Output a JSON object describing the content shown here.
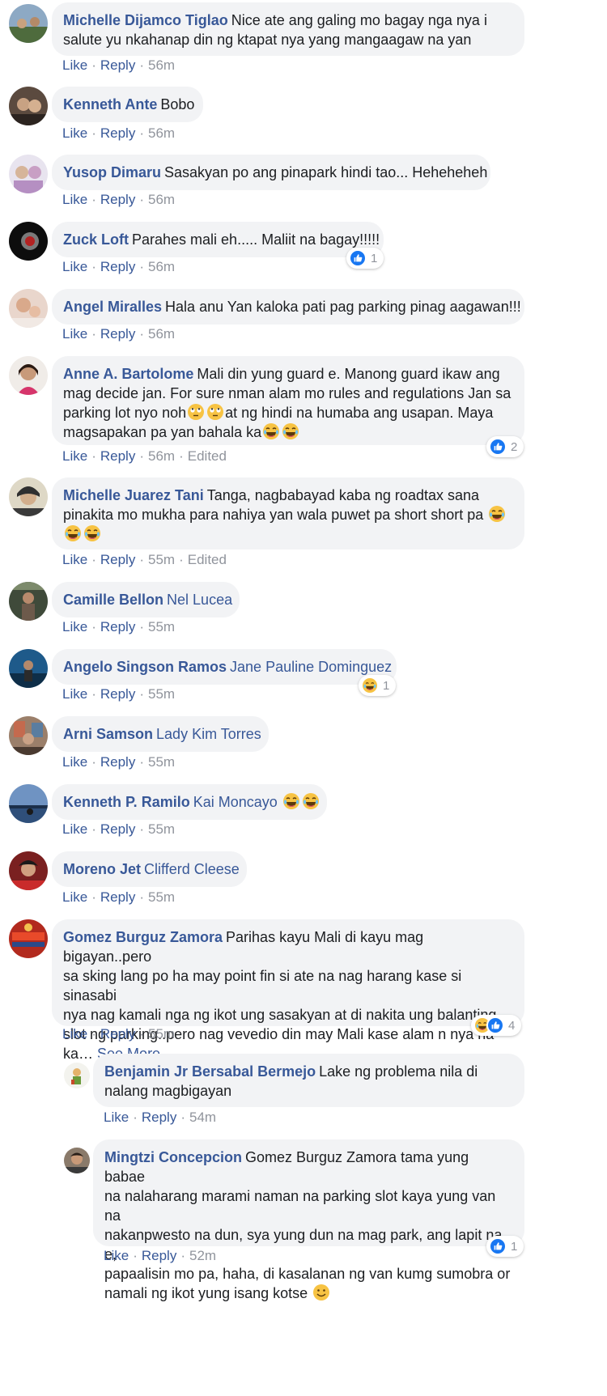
{
  "colors": {
    "link": "#385898",
    "bubble": "#f2f3f5",
    "meta": "#90949c",
    "like_blue": "#1877f2"
  },
  "actions": {
    "like": "Like",
    "reply": "Reply",
    "edited": "Edited",
    "see_more": "See More"
  },
  "comments": [
    {
      "name": "Michelle Dijamco Tiglao",
      "line1": "Nice ate ang galing mo bagay nga nya i",
      "line2": "salute yu nkahanap din ng ktapat nya yang mangaagaw na yan",
      "time": "56m"
    },
    {
      "name": "Kenneth Ante",
      "text": "Bobo",
      "time": "56m"
    },
    {
      "name": "Yusop Dimaru",
      "text": "Sasakyan po ang pinapark hindi tao... Heheheheh",
      "time": "56m"
    },
    {
      "name": "Zuck Loft",
      "text": "Parahes mali eh..... Maliit na bagay!!!!!",
      "time": "56m",
      "reaction_count": "1"
    },
    {
      "name": "Angel Miralles",
      "text": "Hala anu Yan kaloka pati pag parking pinag aagawan!!!",
      "time": "56m"
    },
    {
      "name": "Anne A. Bartolome",
      "line1": "Mali din yung guard e. Manong guard ikaw ang",
      "line2": "mag decide jan. For sure nman alam mo rules and regulations Jan sa",
      "line3a": "parking lot nyo noh",
      "line3b": "at ng hindi na humaba ang usapan. Maya",
      "line4": "magsapakan pa yan bahala ka",
      "time": "56m",
      "reaction_count": "2"
    },
    {
      "name": "Michelle Juarez Tani",
      "line1": "Tanga, nagbabayad kaba ng roadtax sana",
      "line2": "pinakita mo mukha para nahiya yan wala puwet pa short short pa",
      "time": "55m"
    },
    {
      "name": "Camille Bellon",
      "mention": "Nel Lucea",
      "time": "55m"
    },
    {
      "name": "Angelo Singson Ramos",
      "mention": "Jane Pauline Dominguez",
      "time": "55m",
      "reaction_count": "1"
    },
    {
      "name": "Arni Samson",
      "mention": "Lady Kim Torres",
      "time": "55m"
    },
    {
      "name": "Kenneth P. Ramilo",
      "mention": "Kai Moncayo",
      "time": "55m"
    },
    {
      "name": "Moreno Jet",
      "mention": "Clifferd Cleese",
      "time": "55m"
    },
    {
      "name": "Gomez Burguz Zamora",
      "line1": "Parihas kayu Mali di kayu mag bigayan..pero",
      "line2": "sa sking lang po ha may point fin si ate na nag harang kase si sinasabi",
      "line3": "nya nag kamali nga ng ikot ung sasakyan at di nakita ung balanting",
      "line4": "slot ng parking..pero nag vevedio din may Mali kase alam n nya na",
      "line5": "ka…",
      "time": "55m",
      "reaction_count": "4"
    }
  ],
  "replies": [
    {
      "name": "Benjamin Jr Bersabal Bermejo",
      "line1": "Lake ng problema nila di",
      "line2": "nalang magbigayan",
      "time": "54m"
    },
    {
      "name": "Mingtzi Concepcion",
      "line1": "Gomez Burguz Zamora tama yung babae",
      "line2": "na nalaharang marami naman na parking slot kaya yung van na",
      "line3": "nakanpwesto na dun, sya yung dun na mag park, ang lapit na e,",
      "line4": "papaalisin mo pa, haha, di kasalanan ng van kumg sumobra or",
      "line5": "namali ng ikot yung isang kotse",
      "time": "52m",
      "reaction_count": "1"
    }
  ]
}
